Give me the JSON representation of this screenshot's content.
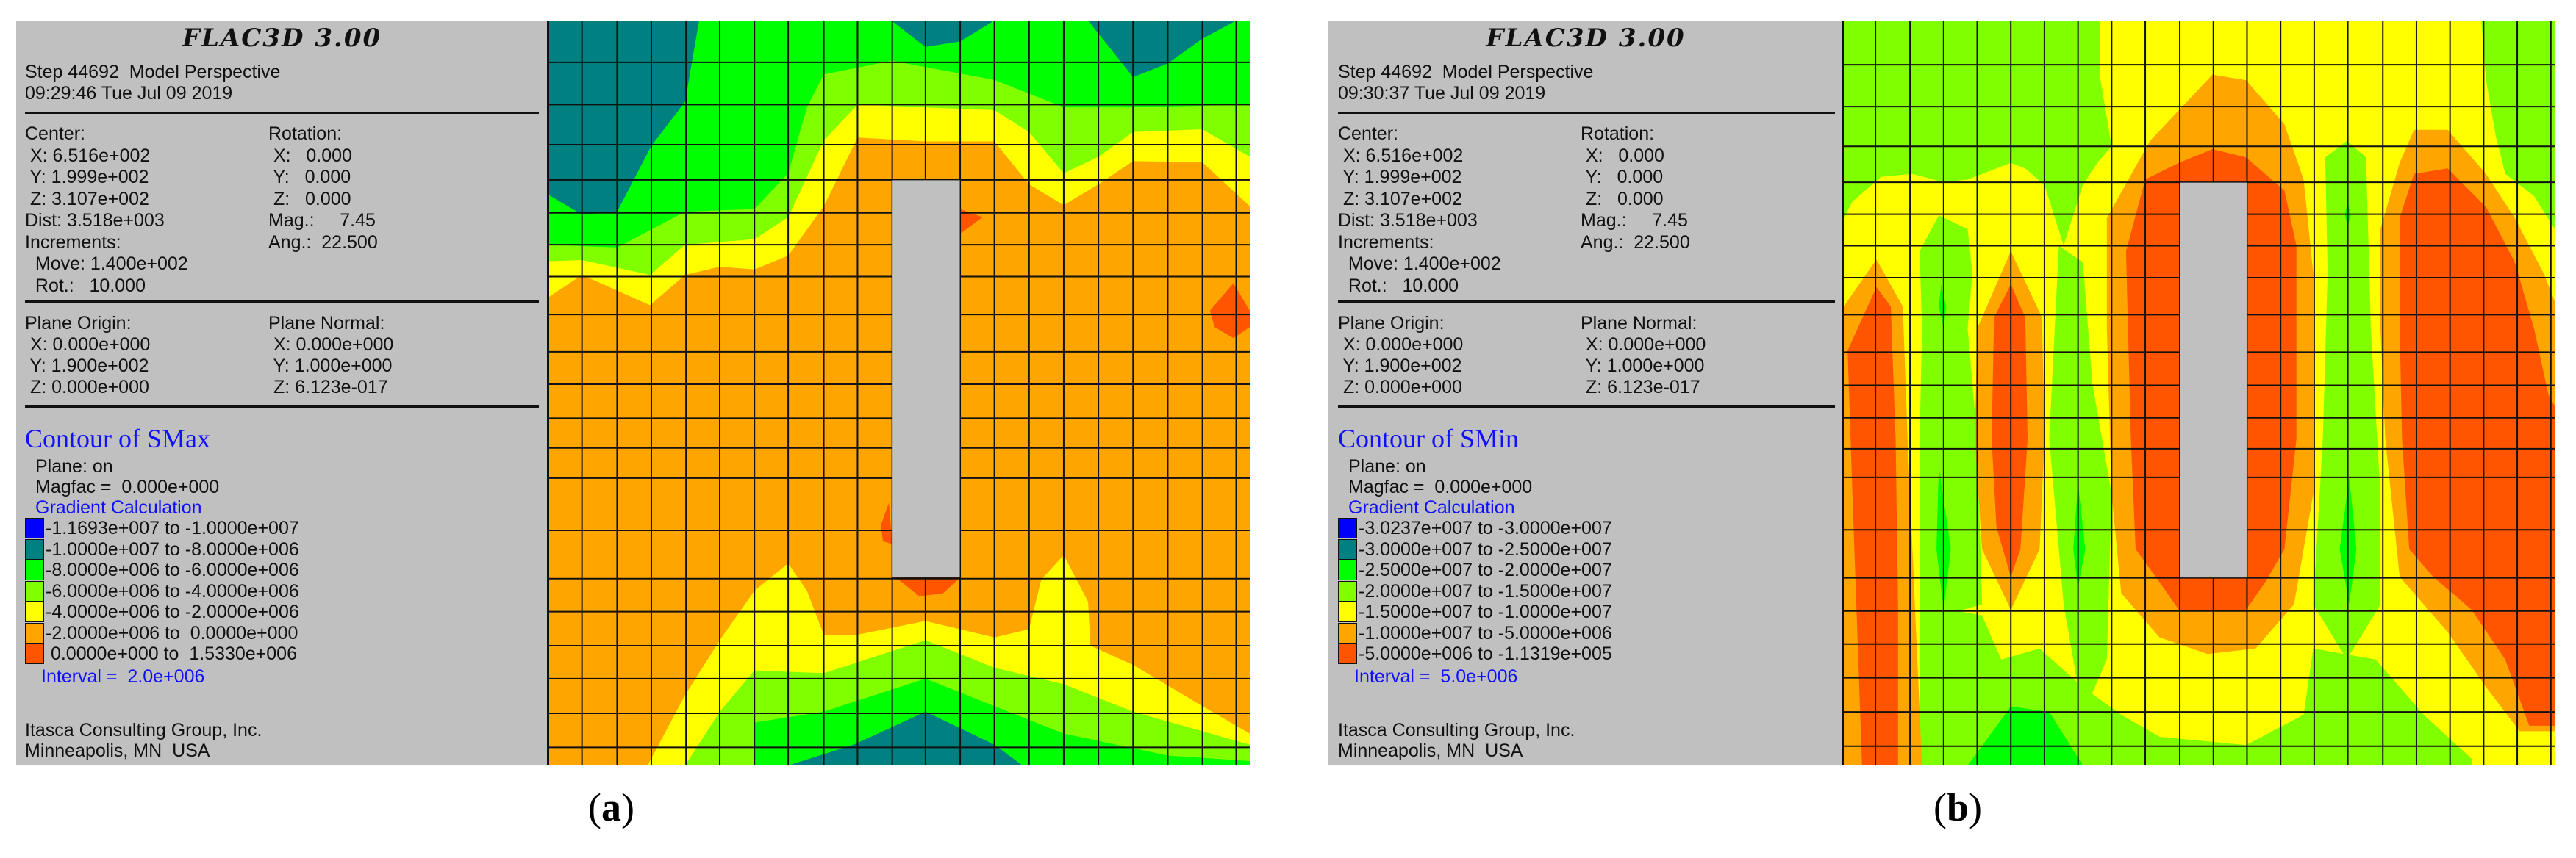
{
  "panels": [
    {
      "title": "FLAC3D 3.00",
      "step_line": "Step 44692  Model Perspective",
      "time_line": "09:29:46 Tue Jul 09 2019",
      "center_label": "Center:",
      "center_x": " X: 6.516e+002",
      "center_y": " Y: 1.999e+002",
      "center_z": " Z: 3.107e+002",
      "dist": "Dist: 3.518e+003",
      "increments": "Increments:",
      "move": "  Move: 1.400e+002",
      "rot": "  Rot.:   10.000",
      "rotation_label": "Rotation:",
      "rotation_x": " X:   0.000",
      "rotation_y": " Y:   0.000",
      "rotation_z": " Z:   0.000",
      "mag": "Mag.:     7.45",
      "ang": "Ang.:  22.500",
      "plane_origin_label": "Plane Origin:",
      "plane_origin_x": " X: 0.000e+000",
      "plane_origin_y": " Y: 1.900e+002",
      "plane_origin_z": " Z: 0.000e+000",
      "plane_normal_label": "Plane Normal:",
      "plane_normal_x": " X: 0.000e+000",
      "plane_normal_y": " Y: 1.000e+000",
      "plane_normal_z": " Z: 6.123e-017",
      "contour_title": "Contour of SMax",
      "plane_on": "Plane: on",
      "magfac": "Magfac =  0.000e+000",
      "gradient": "Gradient Calculation",
      "legend": [
        {
          "range": "-1.1693e+007 to -1.0000e+007",
          "color": "#0000ff"
        },
        {
          "range": "-1.0000e+007 to -8.0000e+006",
          "color": "#008080"
        },
        {
          "range": "-8.0000e+006 to -6.0000e+006",
          "color": "#00ff00"
        },
        {
          "range": "-6.0000e+006 to -4.0000e+006",
          "color": "#80ff00"
        },
        {
          "range": "-4.0000e+006 to -2.0000e+006",
          "color": "#ffff00"
        },
        {
          "range": "-2.0000e+006 to  0.0000e+000",
          "color": "#ffa500"
        },
        {
          "range": " 0.0000e+000 to  1.5330e+006",
          "color": "#ff5500"
        }
      ],
      "interval": "Interval =  2.0e+006",
      "company": "Itasca Consulting Group, Inc.",
      "location": "Minneapolis, MN  USA",
      "caption_letter": "a"
    },
    {
      "title": "FLAC3D 3.00",
      "step_line": "Step 44692  Model Perspective",
      "time_line": "09:30:37 Tue Jul 09 2019",
      "center_label": "Center:",
      "center_x": " X: 6.516e+002",
      "center_y": " Y: 1.999e+002",
      "center_z": " Z: 3.107e+002",
      "dist": "Dist: 3.518e+003",
      "increments": "Increments:",
      "move": "  Move: 1.400e+002",
      "rot": "  Rot.:   10.000",
      "rotation_label": "Rotation:",
      "rotation_x": " X:   0.000",
      "rotation_y": " Y:   0.000",
      "rotation_z": " Z:   0.000",
      "mag": "Mag.:     7.45",
      "ang": "Ang.:  22.500",
      "plane_origin_label": "Plane Origin:",
      "plane_origin_x": " X: 0.000e+000",
      "plane_origin_y": " Y: 1.900e+002",
      "plane_origin_z": " Z: 0.000e+000",
      "plane_normal_label": "Plane Normal:",
      "plane_normal_x": " X: 0.000e+000",
      "plane_normal_y": " Y: 1.000e+000",
      "plane_normal_z": " Z: 6.123e-017",
      "contour_title": "Contour of SMin",
      "plane_on": "Plane: on",
      "magfac": "Magfac =  0.000e+000",
      "gradient": "Gradient Calculation",
      "legend": [
        {
          "range": "-3.0237e+007 to -3.0000e+007",
          "color": "#0000ff"
        },
        {
          "range": "-3.0000e+007 to -2.5000e+007",
          "color": "#008080"
        },
        {
          "range": "-2.5000e+007 to -2.0000e+007",
          "color": "#00ff00"
        },
        {
          "range": "-2.0000e+007 to -1.5000e+007",
          "color": "#80ff00"
        },
        {
          "range": "-1.5000e+007 to -1.0000e+007",
          "color": "#ffff00"
        },
        {
          "range": "-1.0000e+007 to -5.0000e+006",
          "color": "#ffa500"
        },
        {
          "range": "-5.0000e+006 to -1.1319e+005",
          "color": "#ff5500"
        }
      ],
      "interval": "Interval =  5.0e+006",
      "company": "Itasca Consulting Group, Inc.",
      "location": "Minneapolis, MN  USA",
      "caption_letter": "b"
    }
  ]
}
